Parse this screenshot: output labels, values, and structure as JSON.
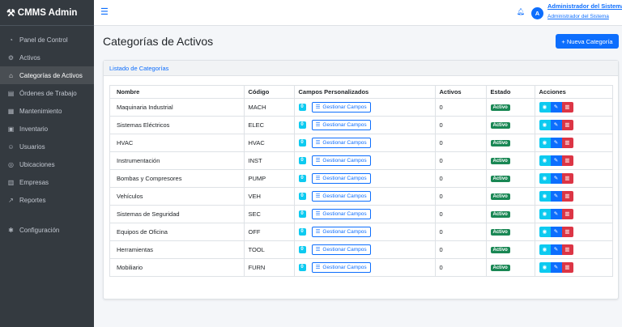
{
  "brand": {
    "title": "CMMS Admin"
  },
  "sidebar": {
    "items": [
      {
        "label": "Panel de Control",
        "icon": "dashboard-icon"
      },
      {
        "label": "Activos",
        "icon": "gear-icon"
      },
      {
        "label": "Categorías de Activos",
        "icon": "tag-icon",
        "active": true
      },
      {
        "label": "Órdenes de Trabajo",
        "icon": "clipboard-icon"
      },
      {
        "label": "Mantenimiento",
        "icon": "calendar-icon"
      },
      {
        "label": "Inventario",
        "icon": "box-icon"
      },
      {
        "label": "Usuarios",
        "icon": "users-icon"
      },
      {
        "label": "Ubicaciones",
        "icon": "location-icon"
      },
      {
        "label": "Empresas",
        "icon": "building-icon"
      },
      {
        "label": "Reportes",
        "icon": "chart-icon"
      }
    ],
    "config": {
      "label": "Configuración",
      "icon": "settings-icon"
    }
  },
  "topbar": {
    "user_initial": "A",
    "user_name": "Administrador del Sistema",
    "user_role": "Administrador del Sistema"
  },
  "page": {
    "title": "Categorías de Activos",
    "new_button": "+ Nueva Categoría"
  },
  "card": {
    "title": "Listado de Categorías"
  },
  "table": {
    "headers": {
      "name": "Nombre",
      "code": "Código",
      "fields": "Campos Personalizados",
      "active": "Activos",
      "state": "Estado",
      "actions": "Acciones"
    },
    "manage_label": "Gestionar Campos",
    "rows": [
      {
        "name": "Maquinaria Industrial",
        "code": "MACH",
        "fields": "0",
        "active": "0",
        "state": "Activo"
      },
      {
        "name": "Sistemas Eléctricos",
        "code": "ELEC",
        "fields": "0",
        "active": "0",
        "state": "Activo"
      },
      {
        "name": "HVAC",
        "code": "HVAC",
        "fields": "0",
        "active": "0",
        "state": "Activo"
      },
      {
        "name": "Instrumentación",
        "code": "INST",
        "fields": "0",
        "active": "0",
        "state": "Activo"
      },
      {
        "name": "Bombas y Compresores",
        "code": "PUMP",
        "fields": "0",
        "active": "0",
        "state": "Activo"
      },
      {
        "name": "Vehículos",
        "code": "VEH",
        "fields": "0",
        "active": "0",
        "state": "Activo"
      },
      {
        "name": "Sistemas de Seguridad",
        "code": "SEC",
        "fields": "0",
        "active": "0",
        "state": "Activo"
      },
      {
        "name": "Equipos de Oficina",
        "code": "OFF",
        "fields": "0",
        "active": "0",
        "state": "Activo"
      },
      {
        "name": "Herramientas",
        "code": "TOOL",
        "fields": "0",
        "active": "0",
        "state": "Activo"
      },
      {
        "name": "Mobiliario",
        "code": "FURN",
        "fields": "0",
        "active": "0",
        "state": "Activo"
      }
    ]
  },
  "colors": {
    "sidebar_bg": "#343a40",
    "primary": "#0d6efd",
    "info": "#0dcaf0",
    "success": "#198754",
    "danger": "#dc3545"
  }
}
